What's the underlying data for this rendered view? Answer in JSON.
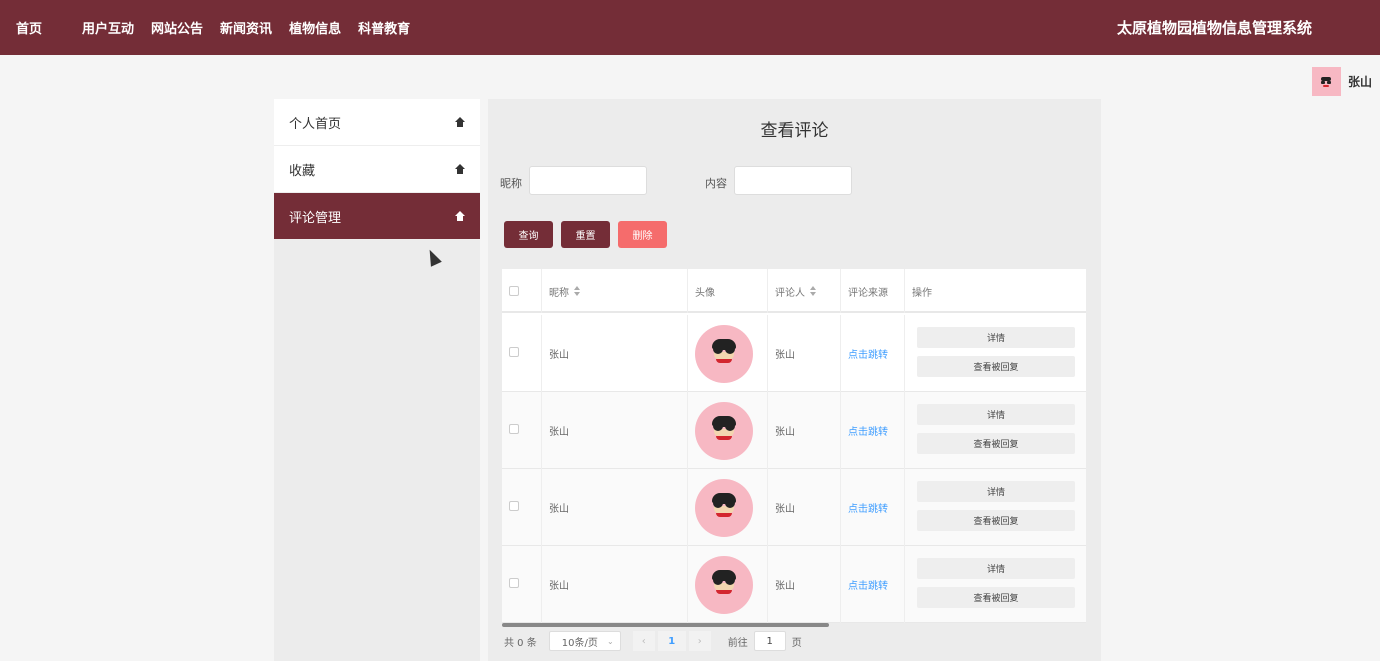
{
  "nav": {
    "items": [
      "首页",
      "用户互动",
      "网站公告",
      "新闻资讯",
      "植物信息",
      "科普教育"
    ],
    "site_title": "太原植物园植物信息管理系统"
  },
  "user": {
    "name": "张山"
  },
  "sidebar": {
    "items": [
      {
        "label": "个人首页",
        "icon": "home-icon",
        "active": false
      },
      {
        "label": "收藏",
        "icon": "home-icon",
        "active": false
      },
      {
        "label": "评论管理",
        "icon": "home-icon",
        "active": true
      }
    ]
  },
  "main": {
    "title": "查看评论",
    "search": {
      "nickname_label": "昵称",
      "nickname_value": "",
      "content_label": "内容",
      "content_value": ""
    },
    "buttons": {
      "query": "查询",
      "reset": "重置",
      "delete": "删除"
    },
    "colors": {
      "primary": "#742d37",
      "danger": "#f56c6c",
      "link": "#409eff"
    }
  },
  "table": {
    "headers": [
      "昵称",
      "头像",
      "评论人",
      "评论来源",
      "操作"
    ],
    "rows": [
      {
        "nickname": "张山",
        "commenter": "张山",
        "source": "点击跳转",
        "detail": "详情",
        "reply": "查看被回复"
      },
      {
        "nickname": "张山",
        "commenter": "张山",
        "source": "点击跳转",
        "detail": "详情",
        "reply": "查看被回复"
      },
      {
        "nickname": "张山",
        "commenter": "张山",
        "source": "点击跳转",
        "detail": "详情",
        "reply": "查看被回复"
      },
      {
        "nickname": "张山",
        "commenter": "张山",
        "source": "点击跳转",
        "detail": "详情",
        "reply": "查看被回复"
      }
    ]
  },
  "pagination": {
    "total": "共 0 条",
    "page_size": "10条/页",
    "current_page": "1",
    "goto_label": "前往",
    "goto_value": "1",
    "page_suffix": "页"
  }
}
